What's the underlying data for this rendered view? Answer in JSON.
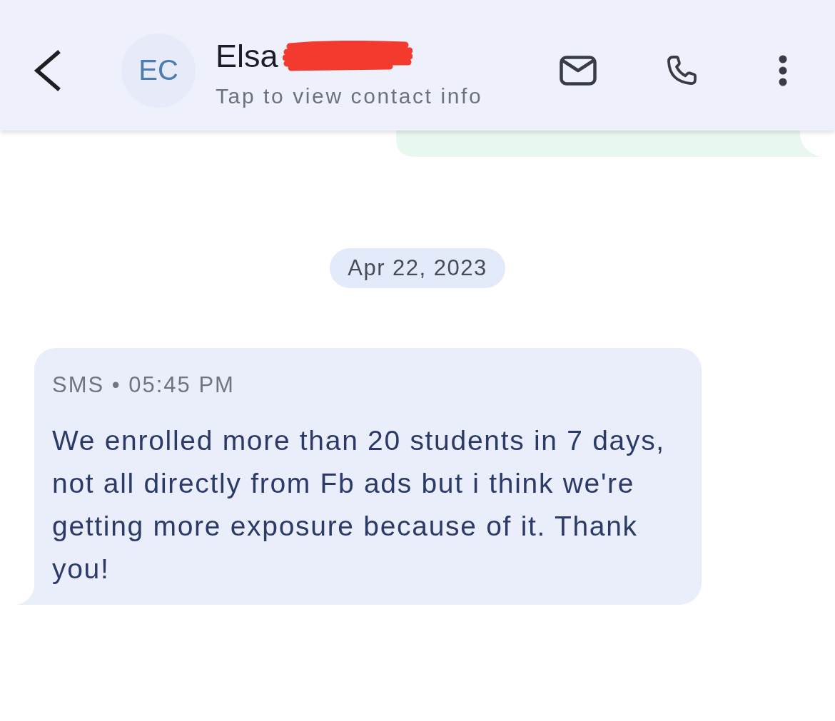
{
  "header": {
    "avatar_initials": "EC",
    "name": "Elsa",
    "name_redacted": true,
    "subtitle": "Tap to view contact info"
  },
  "thread": [
    {
      "kind": "outgoing"
    },
    {
      "kind": "date",
      "text": "Apr 22, 2023"
    },
    {
      "kind": "incoming",
      "meta": "SMS • 05:45 PM",
      "text": "We enrolled more than 20 students in 7 days, not all directly from Fb ads but i think we're getting more exposure because of it. Thank you!"
    }
  ]
}
